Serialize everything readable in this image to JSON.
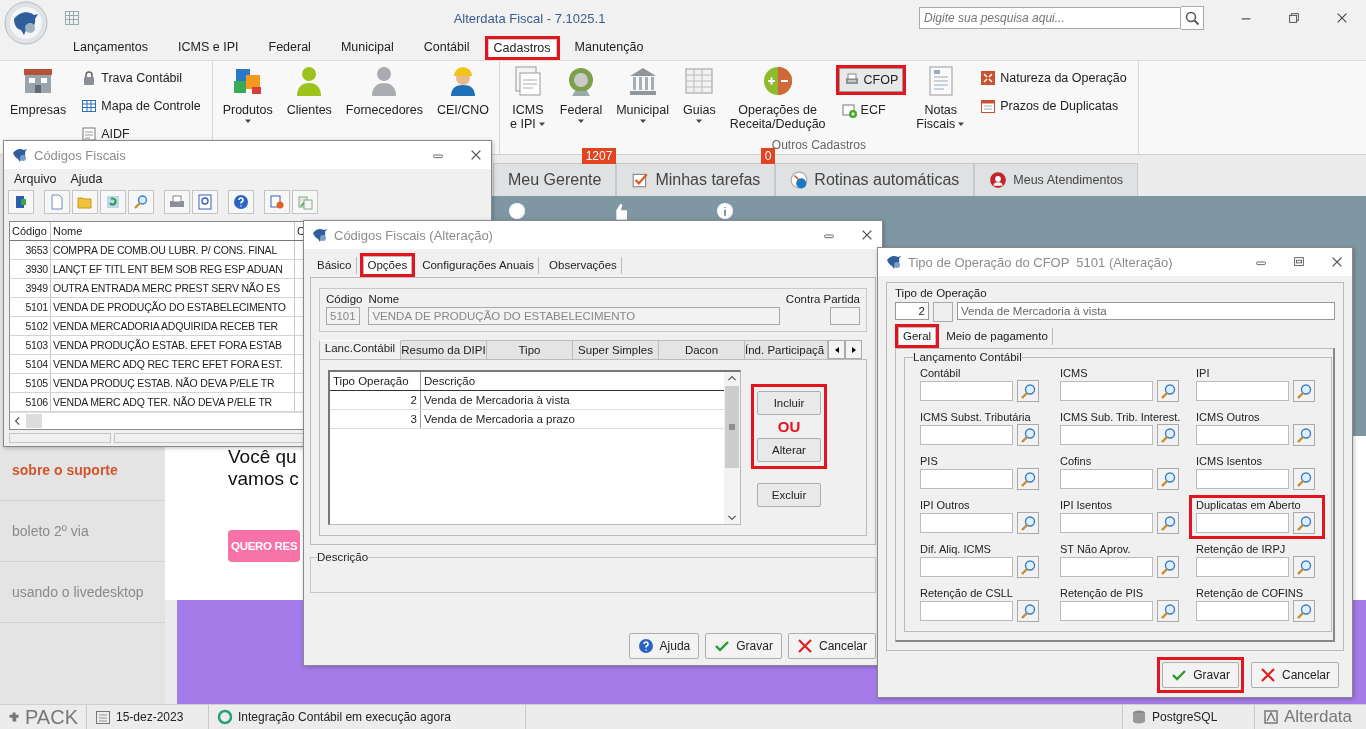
{
  "app": {
    "title": "Alterdata Fiscal - 7.1025.1",
    "search_placeholder": "Digite sua pesquisa aqui..."
  },
  "menu_tabs": [
    {
      "label": "Lançamentos",
      "selected": false,
      "highlighted": false
    },
    {
      "label": "ICMS e IPI",
      "selected": false,
      "highlighted": false
    },
    {
      "label": "Federal",
      "selected": false,
      "highlighted": false
    },
    {
      "label": "Municipal",
      "selected": false,
      "highlighted": false
    },
    {
      "label": "Contábil",
      "selected": false,
      "highlighted": false
    },
    {
      "label": "Cadastros",
      "selected": true,
      "highlighted": true
    },
    {
      "label": "Manutenção",
      "selected": false,
      "highlighted": false
    }
  ],
  "ribbon": {
    "groups": [
      {
        "columns": [
          {
            "kind": "large",
            "label_lines": [
              "Empresas"
            ],
            "dropdown": false
          },
          {
            "kind": "stack",
            "items": [
              {
                "label": "Trava Contábil",
                "highlighted": false
              },
              {
                "label": "Mapa de Controle",
                "highlighted": false
              },
              {
                "label": "AIDF",
                "highlighted": false
              }
            ]
          }
        ]
      },
      {
        "columns": [
          {
            "kind": "large",
            "label_lines": [
              "Produtos"
            ],
            "dropdown": true
          },
          {
            "kind": "large",
            "label_lines": [
              "Clientes"
            ],
            "dropdown": false
          },
          {
            "kind": "large",
            "label_lines": [
              "Fornecedores"
            ],
            "dropdown": false
          },
          {
            "kind": "large",
            "label_lines": [
              "CEI/CNO"
            ],
            "dropdown": false
          }
        ]
      },
      {
        "label": "Outros Cadastros",
        "columns": [
          {
            "kind": "large",
            "label_lines": [
              "ICMS",
              "e IPI"
            ],
            "dropdown": true
          },
          {
            "kind": "large",
            "label_lines": [
              "Federal"
            ],
            "dropdown": true
          },
          {
            "kind": "large",
            "label_lines": [
              "Municipal"
            ],
            "dropdown": true
          },
          {
            "kind": "large",
            "label_lines": [
              "Guias"
            ],
            "dropdown": true
          },
          {
            "kind": "large",
            "label_lines": [
              "Operações de",
              "Receita/Dedução"
            ],
            "dropdown": false
          },
          {
            "kind": "stack",
            "items": [
              {
                "label": "CFOP",
                "highlighted": true
              },
              {
                "label": "ECF",
                "highlighted": false
              }
            ]
          },
          {
            "kind": "large",
            "label_lines": [
              "Notas",
              "Fiscais"
            ],
            "dropdown": true
          },
          {
            "kind": "stack",
            "items": [
              {
                "label": "Natureza da Operação",
                "highlighted": false
              },
              {
                "label": "Prazos de Duplicatas",
                "highlighted": false
              }
            ]
          }
        ]
      }
    ]
  },
  "home_tabs": [
    {
      "label": "Meu Gerente",
      "badge": "1207"
    },
    {
      "label": "Minhas tarefas",
      "badge": "0"
    },
    {
      "label": "Rotinas automáticas"
    },
    {
      "label": "Meus Atendimentos"
    }
  ],
  "side_links": [
    {
      "label": "sobre o suporte",
      "selected": true
    },
    {
      "label": "boleto 2º via",
      "selected": false
    },
    {
      "label": "usando o livedesktop",
      "selected": false
    }
  ],
  "web": {
    "heading_lines": [
      "Você qu",
      "vamos c"
    ],
    "cta": "QUERO RES"
  },
  "fiscal_codes_window": {
    "title": "Códigos Fiscais",
    "menu": [
      "Arquivo",
      "Ajuda"
    ],
    "columns": [
      "Código",
      "Nome",
      "C"
    ],
    "rows": [
      {
        "code": "3653",
        "name": "COMPRA DE COMB.OU LUBR. P/ CONS. FINAL"
      },
      {
        "code": "3930",
        "name": "LANÇT EF TITL ENT BEM SOB REG ESP ADUAN"
      },
      {
        "code": "3949",
        "name": "OUTRA ENTRADA MERC PREST SERV NÃO ES"
      },
      {
        "code": "5101",
        "name": "VENDA DE PRODUÇÃO DO ESTABELECIMENTO"
      },
      {
        "code": "5102",
        "name": "VENDA MERCADORIA ADQUIRIDA RECEB TER"
      },
      {
        "code": "5103",
        "name": "VENDA PRODUÇÃO ESTAB. EFET FORA ESTAB"
      },
      {
        "code": "5104",
        "name": "VENDA MERC ADQ REC TERC EFET FORA EST."
      },
      {
        "code": "5105",
        "name": "VENDA PRODUÇ ESTAB. NÃO DEVA P/ELE TR"
      },
      {
        "code": "5106",
        "name": "VENDA MERC ADQ TER. NÃO DEVA P/ELE TR"
      }
    ]
  },
  "edit_window": {
    "title": "Códigos Fiscais (Alteração)",
    "tabs": [
      {
        "label": "Básico",
        "selected": false,
        "highlighted": false
      },
      {
        "label": "Opções",
        "selected": true,
        "highlighted": true
      },
      {
        "label": "Configurações Anuais",
        "selected": false,
        "highlighted": false
      },
      {
        "label": "Observações",
        "selected": false,
        "highlighted": false
      }
    ],
    "code_label": "Código",
    "code": "5101",
    "name_label": "Nome",
    "name": "VENDA DE PRODUÇÃO DO ESTABELECIMENTO",
    "counterpart_label": "Contra Partida",
    "subtabs": [
      {
        "label": "Lanc.Contábil",
        "selected": true
      },
      {
        "label": "Resumo da DIPI",
        "selected": false
      },
      {
        "label": "Tipo",
        "selected": false
      },
      {
        "label": "Super Simples",
        "selected": false
      },
      {
        "label": "Dacon",
        "selected": false
      },
      {
        "label": "Índ. Participaçã",
        "selected": false
      }
    ],
    "table": {
      "columns": [
        "Tipo Operação",
        "Descrição"
      ],
      "rows": [
        {
          "type": "2",
          "description": "Venda de Mercadoria à vista"
        },
        {
          "type": "3",
          "description": "Venda de Mercadoria a prazo"
        }
      ]
    },
    "actions": {
      "highlighted": true,
      "items": [
        {
          "kind": "button",
          "label": "Incluir"
        },
        {
          "kind": "note",
          "label": "OU"
        },
        {
          "kind": "button",
          "label": "Alterar"
        }
      ]
    },
    "delete_button": "Excluir",
    "description_label": "Descrição",
    "buttons": [
      {
        "kind": "help",
        "label": "Ajuda"
      },
      {
        "kind": "save",
        "label": "Gravar"
      },
      {
        "kind": "cancel",
        "label": "Cancelar"
      }
    ]
  },
  "operation_window": {
    "title": "Tipo de Operação do CFOP  5101 (Alteração)",
    "type_label": "Tipo de Operação",
    "type_code": "2",
    "type_description": "Venda de Mercadoria à vista",
    "tabs": [
      {
        "label": "Geral",
        "selected": true,
        "highlighted": true
      },
      {
        "label": "Meio de pagamento",
        "selected": false,
        "highlighted": false
      }
    ],
    "group_label": "Lançamento Contábil",
    "fields": [
      {
        "label": "Contábil",
        "highlighted": false
      },
      {
        "label": "ICMS",
        "highlighted": false
      },
      {
        "label": "IPI",
        "highlighted": false
      },
      {
        "label": "ICMS Subst. Tributária",
        "highlighted": false
      },
      {
        "label": "ICMS Sub. Trib. Interest.",
        "highlighted": false
      },
      {
        "label": "ICMS Outros",
        "highlighted": false
      },
      {
        "label": "PIS",
        "highlighted": false
      },
      {
        "label": "Cofins",
        "highlighted": false
      },
      {
        "label": "ICMS Isentos",
        "highlighted": false
      },
      {
        "label": "IPI Outros",
        "highlighted": false
      },
      {
        "label": "IPI Isentos",
        "highlighted": false
      },
      {
        "label": "Duplicatas em Aberto",
        "highlighted": true
      },
      {
        "label": "Dif. Aliq. ICMS",
        "highlighted": false
      },
      {
        "label": "ST Não Aprov.",
        "highlighted": false
      },
      {
        "label": "Retenção de IRPJ",
        "highlighted": false
      },
      {
        "label": "Retenção de CSLL",
        "highlighted": false
      },
      {
        "label": "Retenção de PIS",
        "highlighted": false
      },
      {
        "label": "Retenção de COFINS",
        "highlighted": false
      }
    ],
    "buttons": [
      {
        "kind": "save",
        "label": "Gravar",
        "highlighted": true
      },
      {
        "kind": "cancel",
        "label": "Cancelar",
        "highlighted": false
      }
    ]
  },
  "status_bar": {
    "product": "PACK",
    "date": "15-dez-2023",
    "message": "Integração Contábil em execução agora",
    "database": "PostgreSQL",
    "brand": "Alterdata"
  }
}
